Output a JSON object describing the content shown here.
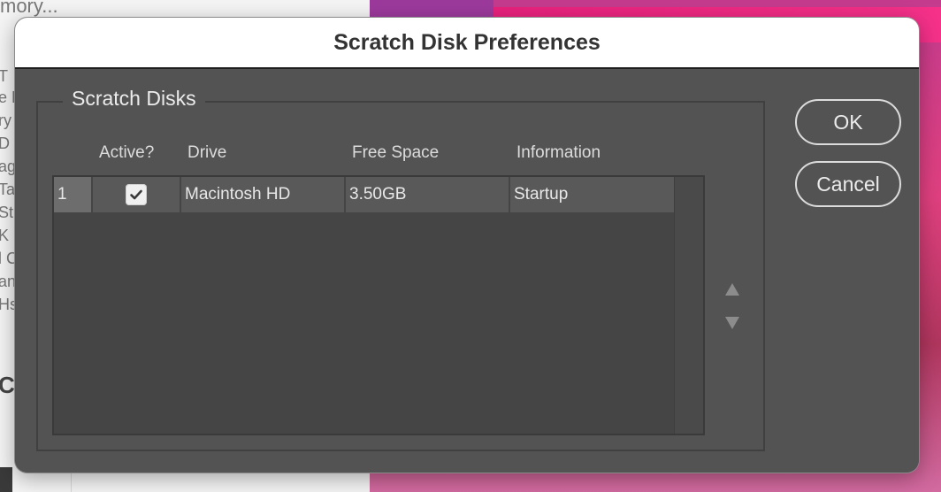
{
  "background": {
    "top_text": "mory...",
    "fragments": [
      "T",
      "e L",
      "ry",
      "D",
      "ag",
      "Ta",
      "St",
      "K",
      "l C",
      "an",
      "Hs"
    ],
    "bottom_fragment": "Cr"
  },
  "dialog": {
    "title": "Scratch Disk Preferences",
    "group_label": "Scratch Disks",
    "columns": {
      "active": "Active?",
      "drive": "Drive",
      "free_space": "Free Space",
      "information": "Information"
    },
    "rows": [
      {
        "index": "1",
        "active": true,
        "drive": "Macintosh HD",
        "free_space": "3.50GB",
        "information": "Startup"
      }
    ],
    "buttons": {
      "ok": "OK",
      "cancel": "Cancel"
    },
    "icons": {
      "move_up": "triangle-up-icon",
      "move_down": "triangle-down-icon",
      "check": "checkmark-icon"
    }
  },
  "colors": {
    "dialog_bg": "#535353",
    "titlebar_bg": "#ffffff",
    "row_bg": "#595959",
    "index_cell_bg": "#6d6d6d",
    "wallpaper": "#e0407f"
  }
}
